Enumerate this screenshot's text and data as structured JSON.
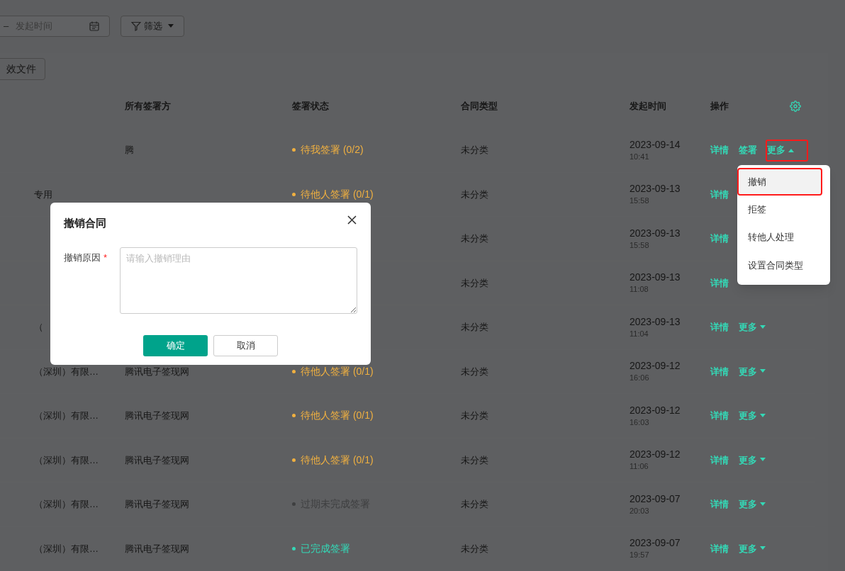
{
  "toolbar": {
    "date_range": {
      "separator": "–",
      "placeholder": "发起时间"
    },
    "filter_button": "筛选"
  },
  "invalid_files_button": "效文件",
  "table": {
    "columns": [
      "所有签署方",
      "签署状态",
      "合同类型",
      "发起时间",
      "操作"
    ],
    "rows": [
      {
        "signers": "腾",
        "status": {
          "label": "待我签署 (0/2)",
          "color": "#f0b040"
        },
        "type": "未分类",
        "date": "2023-09-14",
        "time": "10:41",
        "actions": [
          "详情",
          "签署"
        ],
        "more": {
          "label": "更多",
          "expanded": true
        }
      },
      {
        "column_1": "专用",
        "status": {
          "label": "待他人签署 (0/1)",
          "color": "#f0b040"
        },
        "type": "未分类",
        "date": "2023-09-13",
        "time": "15:58",
        "actions": [
          "详情"
        ]
      },
      {
        "type": "未分类",
        "date": "2023-09-13",
        "time": "15:58",
        "actions": [
          "详情"
        ]
      },
      {
        "type": "未分类",
        "date": "2023-09-13",
        "time": "11:08",
        "actions": [
          "详情"
        ]
      },
      {
        "column_1": "（",
        "type": "未分类",
        "date": "2023-09-13",
        "time": "11:04",
        "actions": [
          "详情"
        ],
        "more": {
          "label": "更多",
          "expanded": false
        }
      },
      {
        "column_1": "（深圳）有限…",
        "signers": "腾讯电子签现网",
        "status": {
          "label": "待他人签署 (0/1)",
          "color": "#f0b040"
        },
        "type": "未分类",
        "date": "2023-09-12",
        "time": "16:06",
        "actions": [
          "详情"
        ],
        "more": {
          "label": "更多",
          "expanded": false
        }
      },
      {
        "column_1": "（深圳）有限…",
        "signers": "腾讯电子签现网",
        "status": {
          "label": "待他人签署 (0/1)",
          "color": "#f0b040"
        },
        "type": "未分类",
        "date": "2023-09-12",
        "time": "16:03",
        "actions": [
          "详情"
        ],
        "more": {
          "label": "更多",
          "expanded": false
        }
      },
      {
        "column_1": "（深圳）有限…",
        "signers": "腾讯电子签现网",
        "status": {
          "label": "待他人签署 (0/1)",
          "color": "#f0b040"
        },
        "type": "未分类",
        "date": "2023-09-12",
        "time": "11:06",
        "actions": [
          "详情"
        ],
        "more": {
          "label": "更多",
          "expanded": false
        }
      },
      {
        "column_1": "（深圳）有限…",
        "signers": "腾讯电子签现网",
        "status": {
          "label": "过期未完成签署",
          "color": "#3e3f40"
        },
        "type": "未分类",
        "date": "2023-09-07",
        "time": "20:03",
        "actions": [
          "详情"
        ],
        "more": {
          "label": "更多",
          "expanded": false
        }
      },
      {
        "column_1": "（深圳）有限…",
        "signers": "腾讯电子签现网",
        "status": {
          "label": "已完成签署",
          "color": "#34d8b6"
        },
        "type": "未分类",
        "date": "2023-09-07",
        "time": "19:57",
        "actions": [
          "详情"
        ],
        "more": {
          "label": "更多",
          "expanded": false
        }
      }
    ]
  },
  "dropdown": {
    "items": [
      {
        "label": "撤销",
        "selected": true
      },
      {
        "label": "拒签",
        "selected": false
      },
      {
        "label": "转他人处理",
        "selected": false
      },
      {
        "label": "设置合同类型",
        "selected": false
      }
    ]
  },
  "dialog": {
    "title": "撤销合同",
    "field": {
      "label": "撤销原因",
      "required_mark": "*",
      "placeholder": "请输入撤销理由"
    },
    "buttons": [
      {
        "label": "确定",
        "kind": "primary"
      },
      {
        "label": "取消",
        "kind": "secondary"
      }
    ]
  }
}
